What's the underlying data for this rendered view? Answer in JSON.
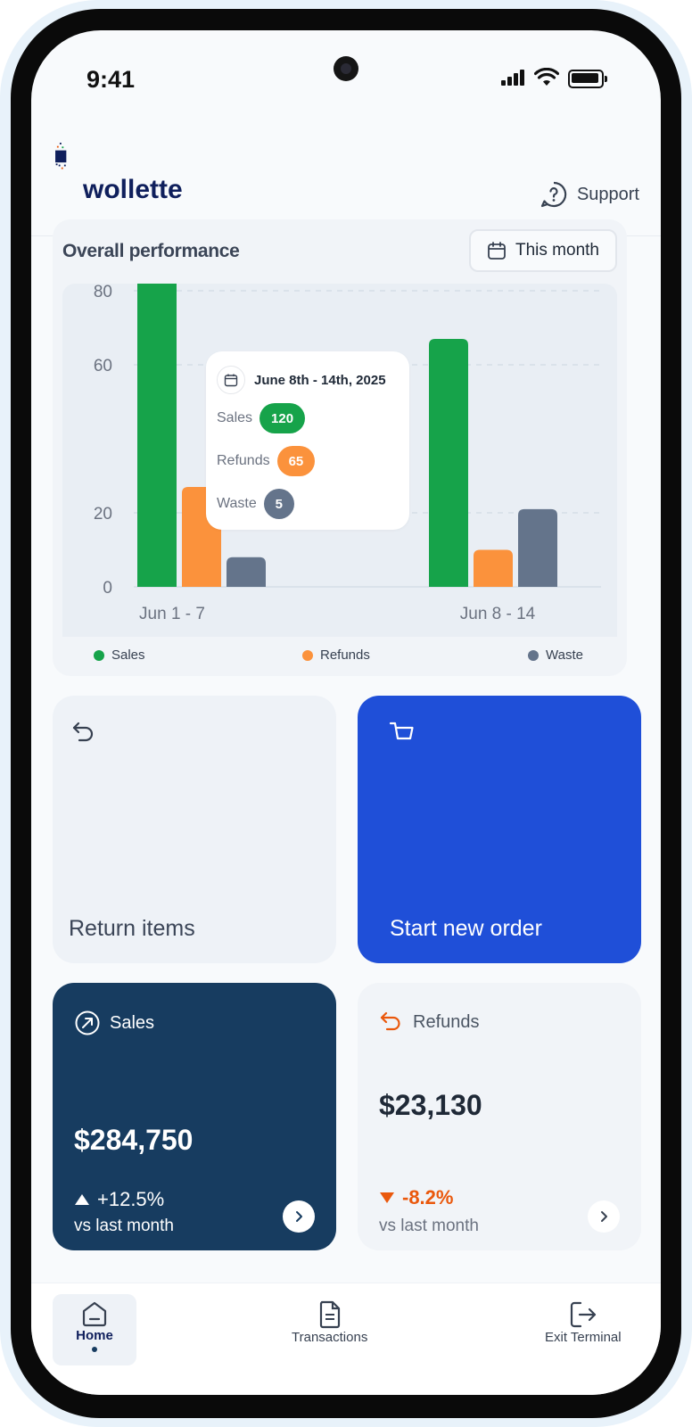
{
  "status_bar": {
    "time": "9:41"
  },
  "header": {
    "brand": "wollette",
    "support_label": "Support"
  },
  "performance": {
    "title": "Overall performance",
    "period_button": "This month",
    "tooltip": {
      "range": "June 8th - 14th, 2025",
      "rows": [
        {
          "label": "Sales",
          "value": "120",
          "color": "#16a34a"
        },
        {
          "label": "Refunds",
          "value": "65",
          "color": "#fb923c"
        },
        {
          "label": "Waste",
          "value": "5",
          "color": "#64748b"
        }
      ]
    },
    "legend": [
      {
        "label": "Sales",
        "color": "#16a34a"
      },
      {
        "label": "Refunds",
        "color": "#fb923c"
      },
      {
        "label": "Waste",
        "color": "#64748b"
      }
    ]
  },
  "chart_data": {
    "type": "bar",
    "categories": [
      "Jun 1 - 7",
      "Jun 8 - 14"
    ],
    "series": [
      {
        "name": "Sales",
        "values": [
          84,
          67
        ],
        "color": "#16a34a"
      },
      {
        "name": "Refunds",
        "values": [
          27,
          10
        ],
        "color": "#fb923c"
      },
      {
        "name": "Waste",
        "values": [
          8,
          21
        ],
        "color": "#64748b"
      }
    ],
    "y_ticks": [
      "0",
      "20",
      "60",
      "80"
    ],
    "ylim": [
      0,
      90
    ],
    "grid": true,
    "legend_position": "bottom"
  },
  "actions": {
    "return_label": "Return items",
    "order_label": "Start new order"
  },
  "stats": {
    "sales": {
      "label": "Sales",
      "value": "$284,750",
      "change": "+12.5%",
      "vs": "vs last month"
    },
    "refunds": {
      "label": "Refunds",
      "value": "$23,130",
      "change": "-8.2%",
      "vs": "vs last month"
    }
  },
  "nav": {
    "home": "Home",
    "transactions": "Transactions",
    "exit": "Exit Terminal"
  },
  "colors": {
    "accent_blue": "#1f4fd8",
    "navy": "#173c60",
    "negative": "#ea580c"
  }
}
